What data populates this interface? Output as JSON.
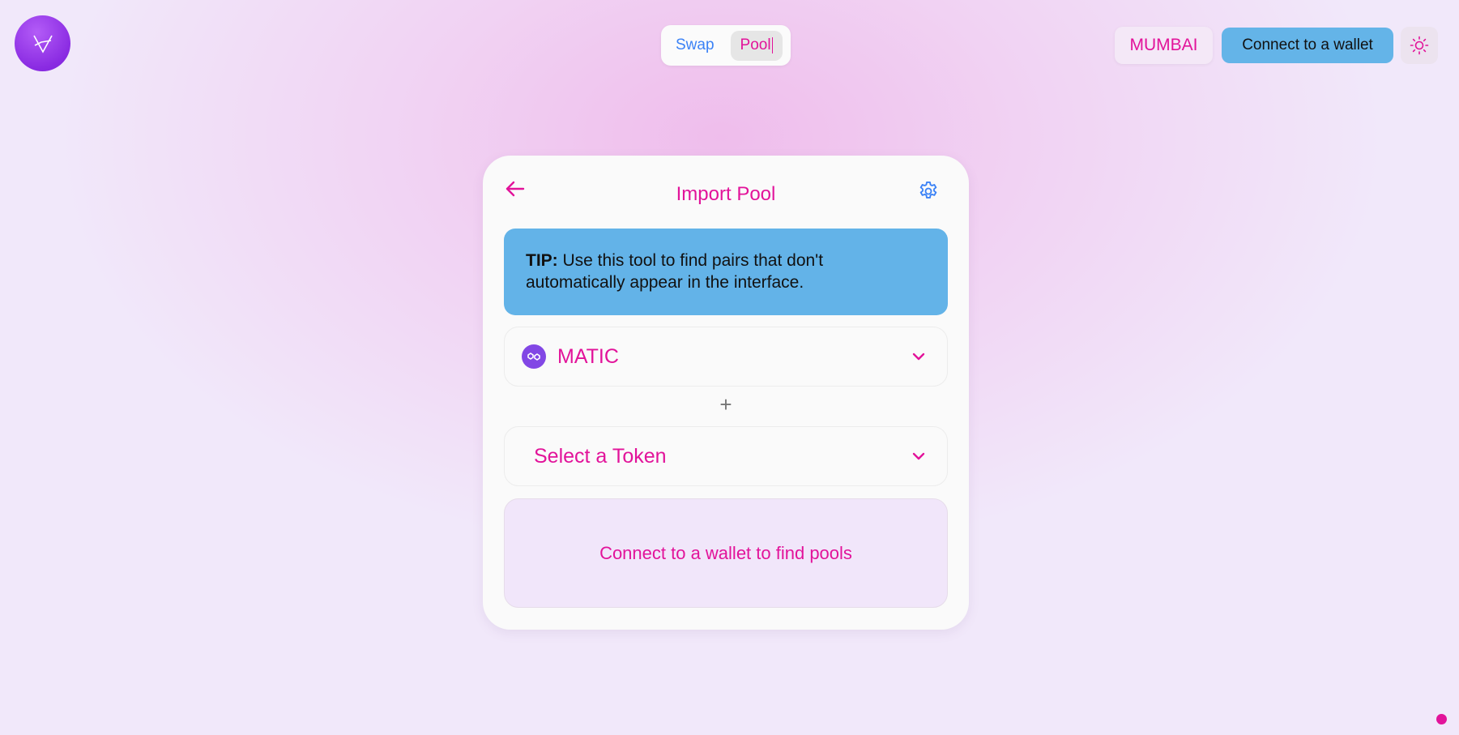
{
  "header": {
    "logo_icon": "nexus-logo-icon",
    "tabs": [
      {
        "label": "Swap",
        "active": false
      },
      {
        "label": "Pool",
        "active": true
      }
    ],
    "network_label": "MUMBAI",
    "connect_label": "Connect to a wallet",
    "theme_icon": "sun-icon"
  },
  "card": {
    "title": "Import Pool",
    "back_icon": "arrow-left-icon",
    "settings_icon": "gear-icon",
    "tip": {
      "prefix": "TIP:",
      "text": " Use this tool to find pairs that don't automatically appear in the interface."
    },
    "token_a": {
      "label": "MATIC",
      "icon": "polygon-icon"
    },
    "plus_symbol": "+",
    "token_b": {
      "label": "Select a Token"
    },
    "find_message": "Connect to a wallet to find pools"
  },
  "colors": {
    "accent_pink": "#e2139a",
    "accent_blue": "#3b82f6",
    "tip_bg": "#63b3e8",
    "logo_purple": "#8a2be2"
  }
}
